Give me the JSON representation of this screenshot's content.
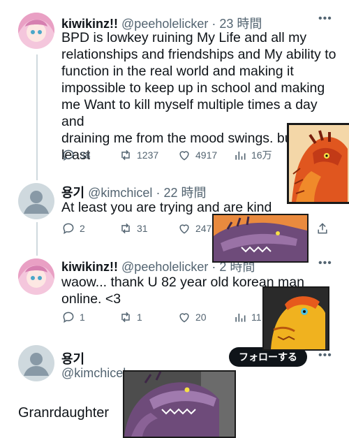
{
  "tweets": [
    {
      "display_name": "kiwikinz!!",
      "handle": "@peeholelicker",
      "time": "· 23 時間",
      "text": "BPD is lowkey ruining My Life and all my\nrelationships and friendships and My ability to\nfunction in the real world and making it\nimpossible to keep up in school  and making\nme Want to kill myself multiple times a day and\ndraining me from the mood swings. but at\nleast",
      "replies": "38",
      "retweets": "1237",
      "likes": "4917",
      "views": "16万"
    },
    {
      "display_name": "용기",
      "handle": "@kimchicel",
      "time": "· 22 時間",
      "text": "At least you are trying and are kind",
      "replies": "2",
      "retweets": "31",
      "likes": "247"
    },
    {
      "display_name": "kiwikinz!!",
      "handle": "@peeholelicker",
      "time": "· 2 時間",
      "text": "waow... thank U 82 year old korean man\nonline. <3",
      "replies": "1",
      "retweets": "1",
      "likes": "20",
      "views": "11"
    }
  ],
  "main_tweet": {
    "display_name": "용기",
    "handle": "@kimchicel",
    "follow_label": "フォローする",
    "text": "Granrdaughter"
  },
  "more_label": "•••",
  "colors": {
    "text": "#0f1419",
    "muted": "#536471",
    "line": "#cfd9de"
  }
}
